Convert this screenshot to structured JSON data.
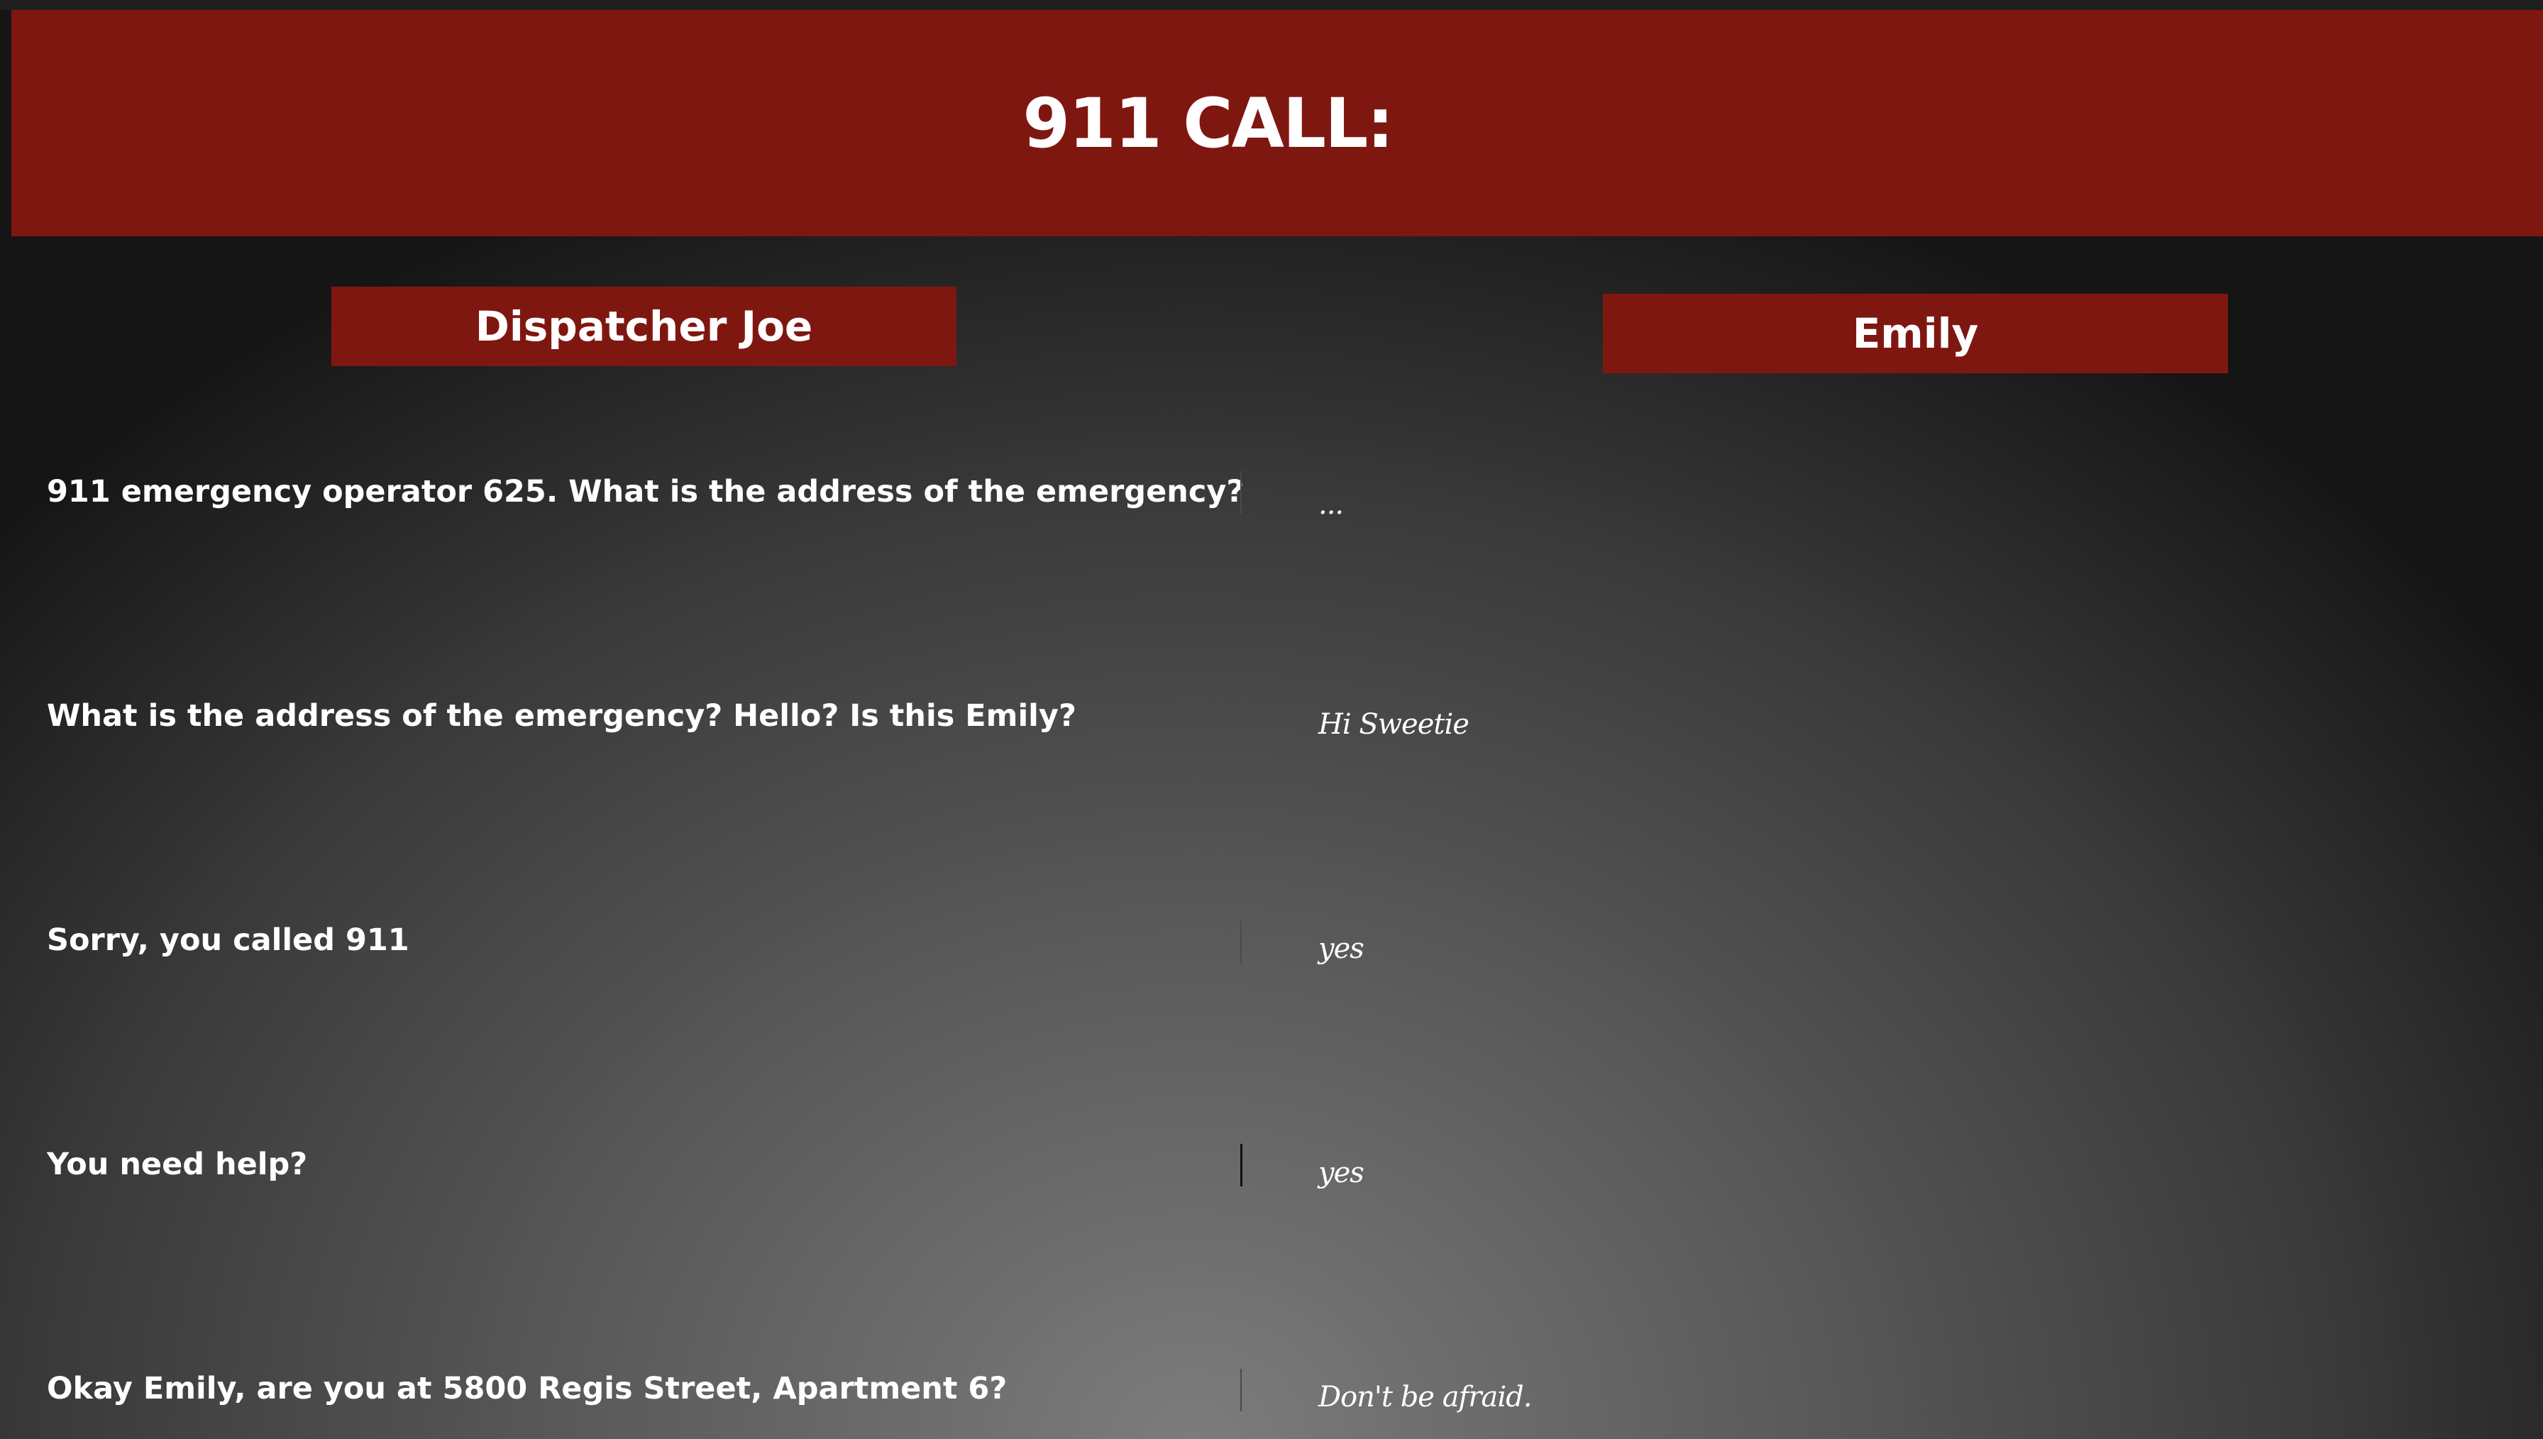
{
  "header": {
    "title": "911 CALL:"
  },
  "speakers": {
    "left": "Dispatcher Joe",
    "right": "Emily"
  },
  "dialogue": [
    {
      "dispatcher": "911 emergency operator 625. What is the address of the emergency?",
      "emily": "..."
    },
    {
      "dispatcher": "What is the address of the emergency? Hello? Is this Emily?",
      "emily": "Hi Sweetie"
    },
    {
      "dispatcher": "Sorry, you called 911",
      "emily": "yes"
    },
    {
      "dispatcher": "You need help?",
      "emily": "yes"
    },
    {
      "dispatcher": "Okay Emily, are you at 5800 Regis Street, Apartment 6?",
      "emily": "Don't be afraid."
    }
  ],
  "colors": {
    "banner": "#7f1711",
    "text": "#ffffff"
  }
}
